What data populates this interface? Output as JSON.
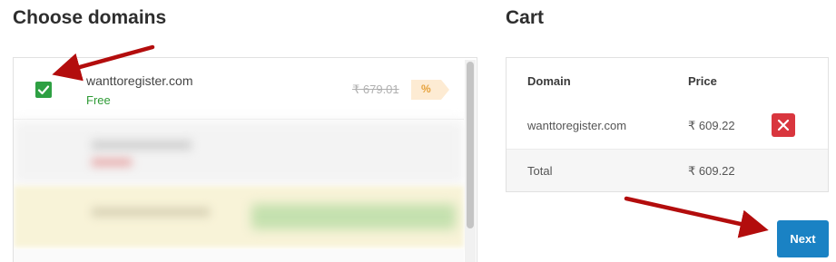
{
  "left_section": {
    "title": "Choose domains",
    "selected_domain": {
      "checked": true,
      "name": "wanttoregister.com",
      "status": "Free",
      "original_price": "₹ 679.01",
      "discount_badge": "%"
    }
  },
  "cart": {
    "title": "Cart",
    "columns": [
      "Domain",
      "Price"
    ],
    "items": [
      {
        "domain": "wanttoregister.com",
        "price": "₹ 609.22"
      }
    ],
    "total_label": "Total",
    "total_value": "₹ 609.22"
  },
  "next_button_label": "Next",
  "colors": {
    "checkbox": "#2ea043",
    "free_text": "#2e9a35",
    "remove_button": "#d9363e",
    "next_button": "#1a82c4",
    "annotation_arrow": "#b30d0d"
  },
  "icons": {
    "checkbox": "check-icon",
    "remove": "close-icon",
    "discount": "discount-tag-icon"
  }
}
